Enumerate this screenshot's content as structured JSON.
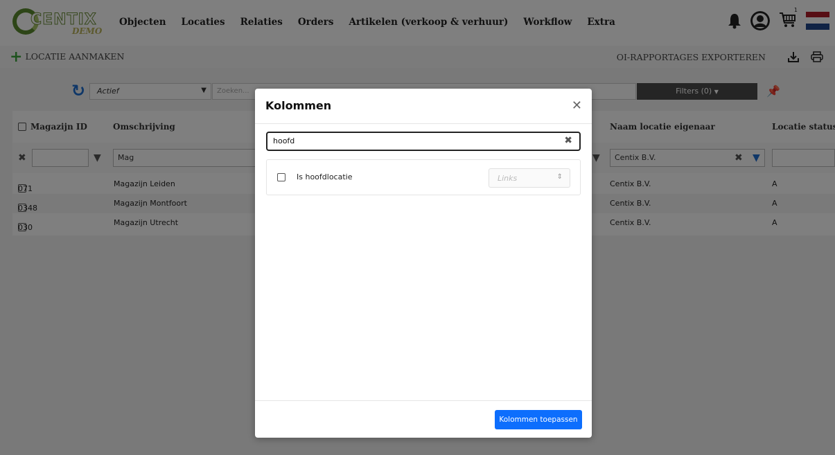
{
  "brand": {
    "name": "CENTIX",
    "tagline": "DEMO"
  },
  "nav": {
    "items": [
      "Objecten",
      "Locaties",
      "Relaties",
      "Orders",
      "Artikelen (verkoop & verhuur)",
      "Workflow",
      "Extra"
    ],
    "cart_count": "1"
  },
  "actionbar": {
    "create_label": "LOCATIE AANMAKEN",
    "export_label": "OI-RAPPORTAGES EXPORTEREN"
  },
  "filterbar": {
    "status_value": "Actief",
    "search_placeholder": "Zoeken...",
    "filters_label": "Filters (0)"
  },
  "table": {
    "headers": {
      "id": "Magazijn ID",
      "desc": "Omschrijving",
      "owner": "Naam locatie eigenaar",
      "status": "Locatie status I"
    },
    "filters": {
      "desc": "Mag",
      "owner": "Centix B.V."
    },
    "rows": [
      {
        "id": "071",
        "desc": "Magazijn Leiden",
        "owner": "Centix B.V.",
        "status": "A"
      },
      {
        "id": "0348",
        "desc": "Magazijn Montfoort",
        "owner": "Centix B.V.",
        "status": "A"
      },
      {
        "id": "030",
        "desc": "Magazijn Utrecht",
        "owner": "Centix B.V.",
        "status": "A"
      }
    ]
  },
  "modal": {
    "title": "Kolommen",
    "search_value": "hoofd",
    "columns": [
      {
        "label": "Is hoofdlocatie",
        "position": "Links"
      }
    ],
    "apply_label": "Kolommen toepassen"
  },
  "colors": {
    "primary": "#0d6efd",
    "refresh": "#1f6fd1",
    "add": "#3aa53a",
    "flag_red": "#ae1c28",
    "flag_blue": "#21468b"
  }
}
